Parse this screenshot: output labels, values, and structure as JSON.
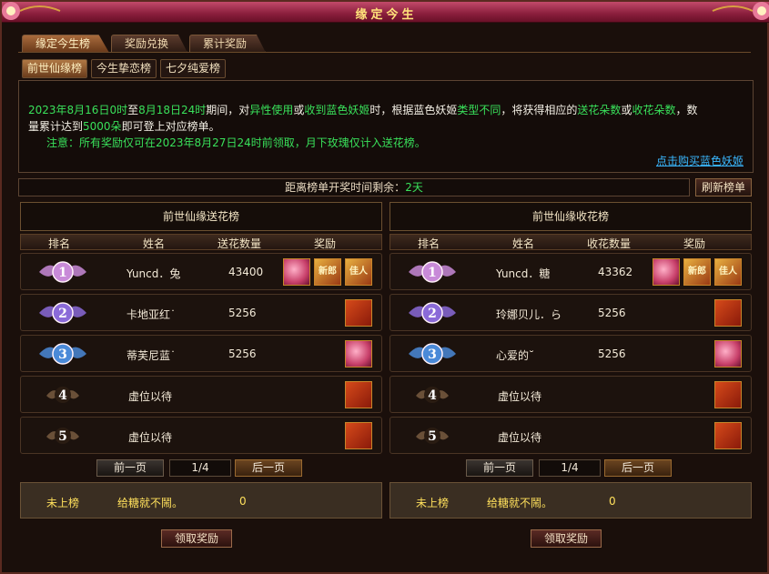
{
  "window": {
    "title": "缘定今生"
  },
  "tabs_main": [
    "缘定今生榜",
    "奖励兑换",
    "累计奖励"
  ],
  "tabs_sub": [
    "前世仙缘榜",
    "今生挚恋榜",
    "七夕纯爱榜"
  ],
  "info": {
    "seg1": "2023年8月16日0时",
    "seg2": "至",
    "seg3": "8月18日24时",
    "seg4": "期间，对",
    "seg5": "异性使用",
    "seg6": "或",
    "seg7": "收到蓝色妖姬",
    "seg8": "时，根据蓝色妖姬",
    "seg9": "类型不同",
    "seg10": "，将获得相应的",
    "seg11": "送花朵数",
    "seg12": "或",
    "seg13": "收花朵数",
    "seg14": "，数",
    "line2a": "量累计达到",
    "line2b": "5000朵",
    "line2c": "即可登上对应榜单。",
    "note": "注意：所有奖励仅可在2023年8月27日24时前领取，月下玫瑰仅计入送花榜。",
    "buy_link": "点击购买蓝色妖姬"
  },
  "timer": {
    "label": "距离榜单开奖时间剩余：",
    "value": "2天"
  },
  "refresh_label": "刷新榜单",
  "left_panel": {
    "title": "前世仙缘送花榜",
    "columns": [
      "排名",
      "姓名",
      "送花数量",
      "奖励"
    ],
    "rows": [
      {
        "rank": "1",
        "name": "Yuncd．兔",
        "count": "43400"
      },
      {
        "rank": "2",
        "name": "卡地亚红˙",
        "count": "5256"
      },
      {
        "rank": "3",
        "name": "蒂芙尼蓝˙",
        "count": "5256"
      },
      {
        "rank": "4",
        "name": "虚位以待",
        "count": ""
      },
      {
        "rank": "5",
        "name": "虚位以待",
        "count": ""
      }
    ],
    "prev": "前一页",
    "page": "1/4",
    "next": "后一页",
    "my_status": "未上榜",
    "my_name": "给糖就不鬧。",
    "my_count": "0",
    "claim": "领取奖励"
  },
  "right_panel": {
    "title": "前世仙缘收花榜",
    "columns": [
      "排名",
      "姓名",
      "收花数量",
      "奖励"
    ],
    "rows": [
      {
        "rank": "1",
        "name": "Yuncd．糖",
        "count": "43362"
      },
      {
        "rank": "2",
        "name": "玲娜贝儿．ら",
        "count": "5256"
      },
      {
        "rank": "3",
        "name": "心爱的˘",
        "count": "5256"
      },
      {
        "rank": "4",
        "name": "虚位以待",
        "count": ""
      },
      {
        "rank": "5",
        "name": "虚位以待",
        "count": ""
      }
    ],
    "prev": "前一页",
    "page": "1/4",
    "next": "后一页",
    "my_status": "未上榜",
    "my_name": "给糖就不鬧。",
    "my_count": "0",
    "claim": "领取奖励"
  },
  "prize_labels": {
    "title_a": "新郎",
    "title_b": "佳人"
  },
  "colors": {
    "green": "#39e05a",
    "yellow": "#ffe05c",
    "link": "#3ab8ff"
  }
}
